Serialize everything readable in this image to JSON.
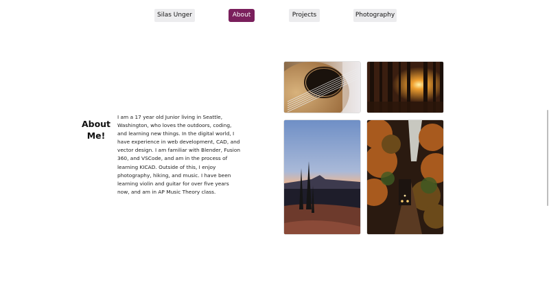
{
  "nav": {
    "items": [
      {
        "label": "Silas Unger",
        "active": false
      },
      {
        "label": "About",
        "active": true
      },
      {
        "label": "Projects",
        "active": false
      },
      {
        "label": "Photography",
        "active": false
      }
    ],
    "active_color": "#7a1f5c"
  },
  "about": {
    "heading": "About Me!",
    "text": "I am a 17 year old Junior living in Seattle, Washington, who loves the outdoors, coding, and learning new things. In the digital world, I have experience in web development, CAD, and vector design. I am familiar with Blender, Fusion 360, and VSCode, and am in the process of learning KICAD. Outside of this, I enjoy photography, hiking, and music. I have been learning violin and guitar for over five years now, and am in AP Music Theory class."
  },
  "photos": [
    {
      "subject": "guitar-sound-hole"
    },
    {
      "subject": "forest-sunset"
    },
    {
      "subject": "mountain-dusk"
    },
    {
      "subject": "train-autumn-forest"
    }
  ]
}
